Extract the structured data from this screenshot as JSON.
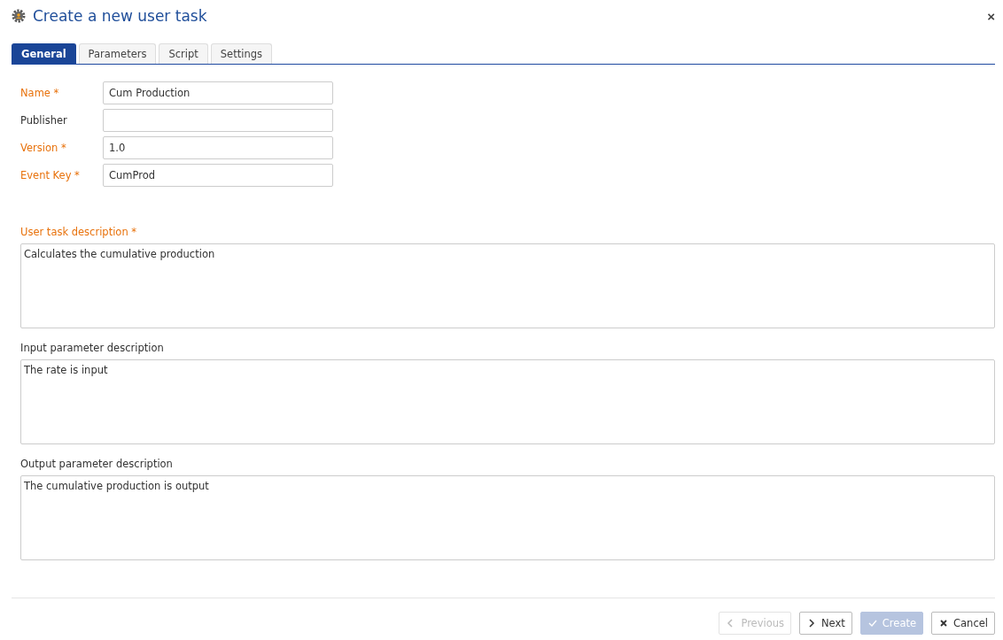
{
  "window": {
    "title": "Create a new user task",
    "close": "×"
  },
  "tabs": [
    {
      "label": "General",
      "selected": true
    },
    {
      "label": "Parameters",
      "selected": false
    },
    {
      "label": "Script",
      "selected": false
    },
    {
      "label": "Settings",
      "selected": false
    }
  ],
  "fields": [
    {
      "label": "Name *",
      "required": true,
      "value": "Cum Production"
    },
    {
      "label": "Publisher",
      "required": false
    },
    {
      "label": "Version *",
      "required": true,
      "value": "1.0"
    },
    {
      "label": "Event Key *",
      "required": true,
      "value": "CumProd"
    }
  ],
  "descriptions": [
    {
      "label": "User task description *",
      "required": true,
      "value": "Calculates the cumulative production"
    },
    {
      "label": "Input parameter description",
      "required": false,
      "value": "The rate is input"
    },
    {
      "label": "Output parameter description",
      "required": false,
      "value": "The cumulative production is output"
    }
  ],
  "buttons": [
    {
      "kind": "previous",
      "label": "Previous",
      "disabled": true
    },
    {
      "kind": "next",
      "label": "Next",
      "disabled": false
    },
    {
      "kind": "create",
      "label": "Create",
      "disabled": true
    },
    {
      "kind": "cancel",
      "label": "Cancel",
      "disabled": false
    }
  ]
}
